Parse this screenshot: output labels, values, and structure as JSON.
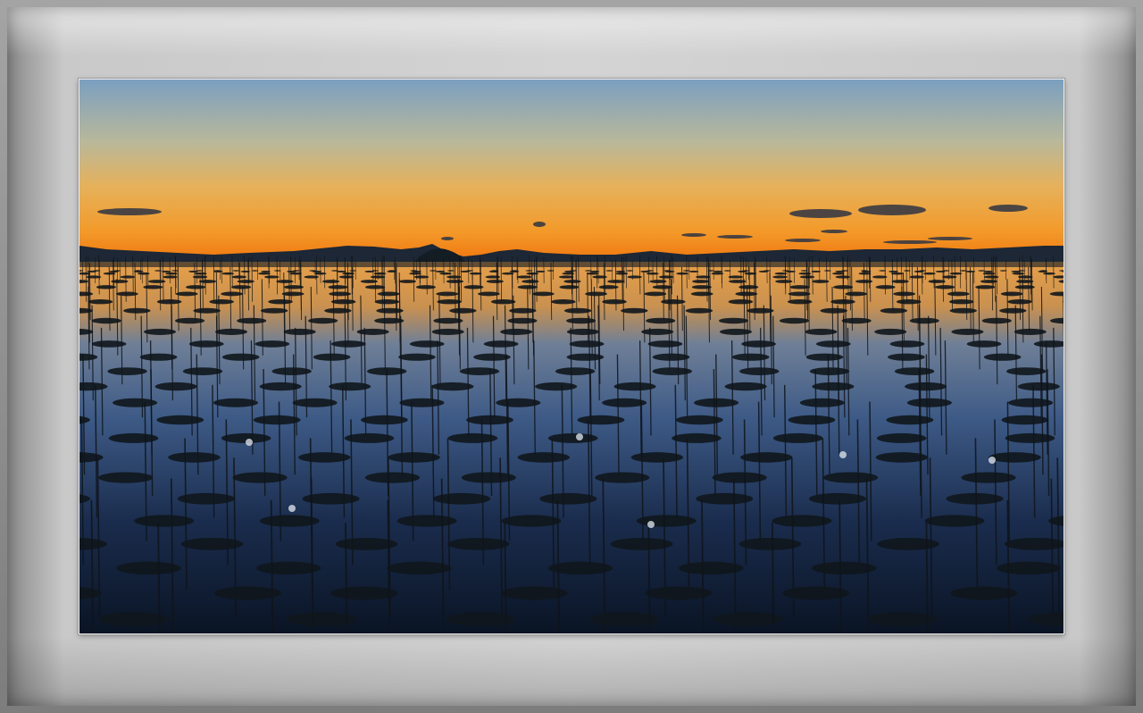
{
  "image": {
    "subject": "sunset-over-seaweed-farm",
    "colors": {
      "sky_top": "#7b9fc0",
      "sky_mid": "#e6b15a",
      "horizon_glow": "#f07a12",
      "water_reflection": "#e8a048",
      "water_deep": "#0c1a30",
      "silhouette": "#141c24"
    }
  }
}
